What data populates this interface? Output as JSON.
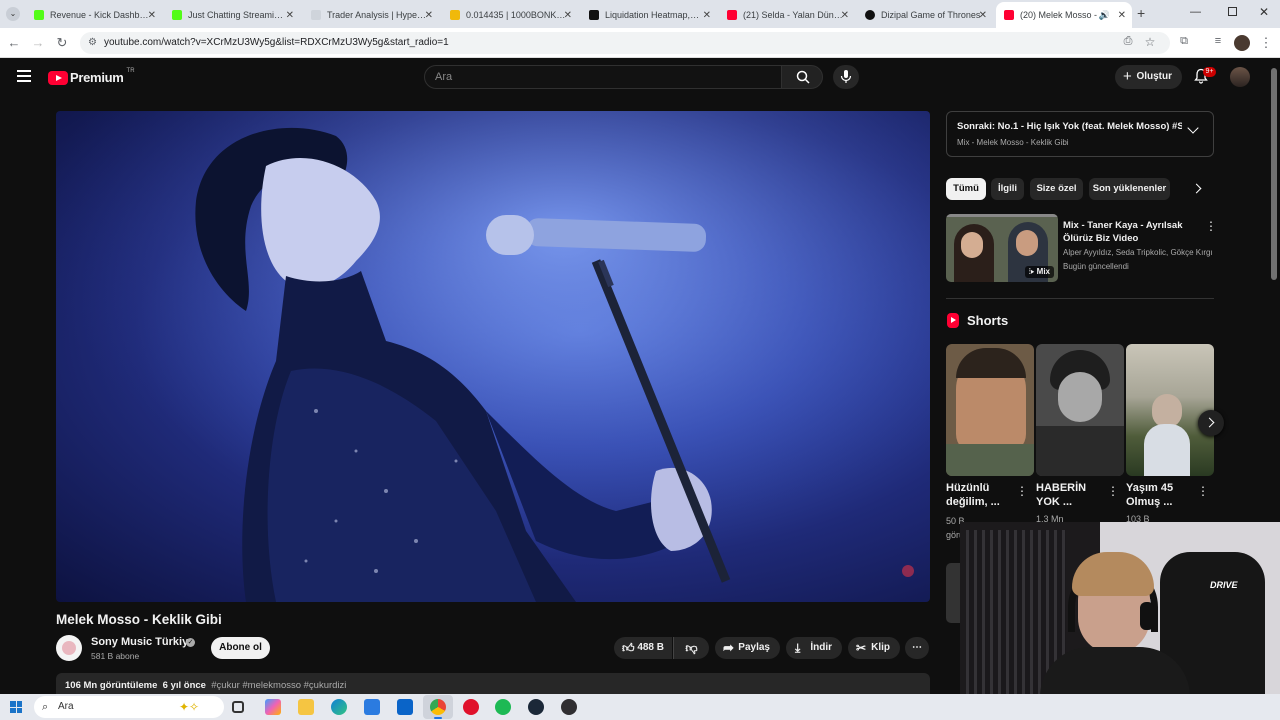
{
  "browser": {
    "tabs": [
      {
        "title": "Revenue - Kick Dashboard",
        "color": "#53fc18"
      },
      {
        "title": "Just Chatting Streaming - ",
        "color": "#53fc18"
      },
      {
        "title": "Trader Analysis | HyperDash",
        "color": "#cfd4db"
      },
      {
        "title": "0.014435 | 1000BONKUSDT",
        "color": "#f0b90b"
      },
      {
        "title": "Liquidation Heatmap,Bitcoin",
        "color": "#111111"
      },
      {
        "title": "(21) Selda - Yalan Dünya",
        "color": "#ff0033"
      },
      {
        "title": "Dizipal Game of Thrones",
        "color": "#111111"
      },
      {
        "title": "(20) Melek Mosso - Keklik",
        "color": "#ff0033"
      }
    ],
    "url": "youtube.com/watch?v=XCrMzU3Wy5g&list=RDXCrMzU3Wy5g&start_radio=1"
  },
  "header": {
    "logo": "Premium",
    "region": "TR",
    "search_placeholder": "Ara",
    "create_label": "Oluştur",
    "notif_badge": "9+"
  },
  "video": {
    "title": "Melek Mosso - Keklik Gibi",
    "channel": "Sony Music Türkiye",
    "subscribers": "581 B abone",
    "subscribe_label": "Abone ol",
    "likes": "488 B",
    "share_label": "Paylaş",
    "download_label": "İndir",
    "clip_label": "Klip",
    "views": "106 Mn görüntüleme",
    "age": "6 yıl önce",
    "hashtags": "#çukur #melekmosso #çukurdizi"
  },
  "sidebar": {
    "next_label": "Sonraki:",
    "next_title": "No.1 - Hiç Işık Yok (feat. Melek Mosso) #Si...",
    "next_sub": "Mix - Melek Mosso - Keklik Gibi",
    "chips": [
      "Tümü",
      "İlgili",
      "Size özel",
      "Son yüklenenler"
    ],
    "mix": {
      "title_line1": "Mix - Taner Kaya - Ayrılsak",
      "title_line2": "Ölürüz Biz Video",
      "artists": "Alper Ayyıldız, Seda Tripkolic, Gökçe Kırgı...",
      "updated": "Bugün güncellendi",
      "badge": "Mix"
    },
    "shorts_label": "Shorts",
    "shorts": [
      {
        "line1": "Hüzünlü",
        "line2": "değilim, ...",
        "meta1": "50 B",
        "meta2": "görün"
      },
      {
        "line1": "HABERİN",
        "line2": "YOK ...",
        "meta1": "1,3 Mn",
        "meta2": ""
      },
      {
        "line1": "Yaşım 45",
        "line2": "Olmuş ...",
        "meta1": "103 B",
        "meta2": ""
      }
    ]
  },
  "taskbar": {
    "search_placeholder": "Ara"
  },
  "webcam": {
    "chair_brand": "DRIVE"
  }
}
